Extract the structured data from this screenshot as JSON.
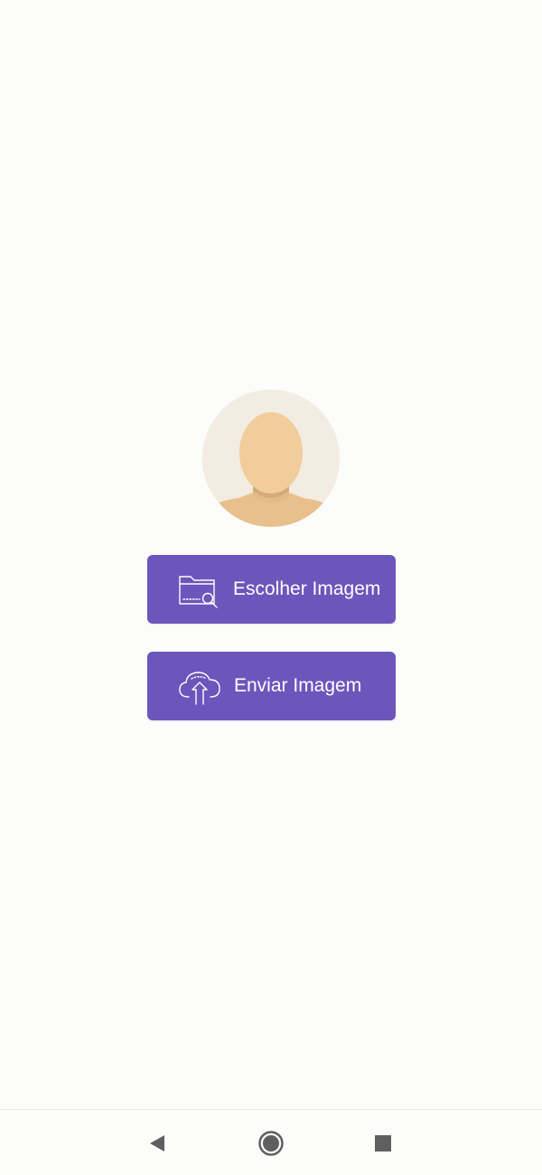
{
  "profile": {
    "avatar_icon": "default-avatar-icon"
  },
  "actions": {
    "choose_image": {
      "label": "Escolher Imagem",
      "icon": "folder-search-icon"
    },
    "send_image": {
      "label": "Enviar Imagem",
      "icon": "cloud-upload-icon"
    }
  },
  "navigation": {
    "back_icon": "back-triangle-icon",
    "home_icon": "home-circle-icon",
    "recents_icon": "recents-square-icon"
  },
  "colors": {
    "background": "#fcfcfa",
    "button": "#6c56bc",
    "button_text": "#ffffff",
    "avatar_bg": "#f2ece2",
    "skin": "#f0cd9a",
    "nav_icon": "#5f5f5f"
  }
}
